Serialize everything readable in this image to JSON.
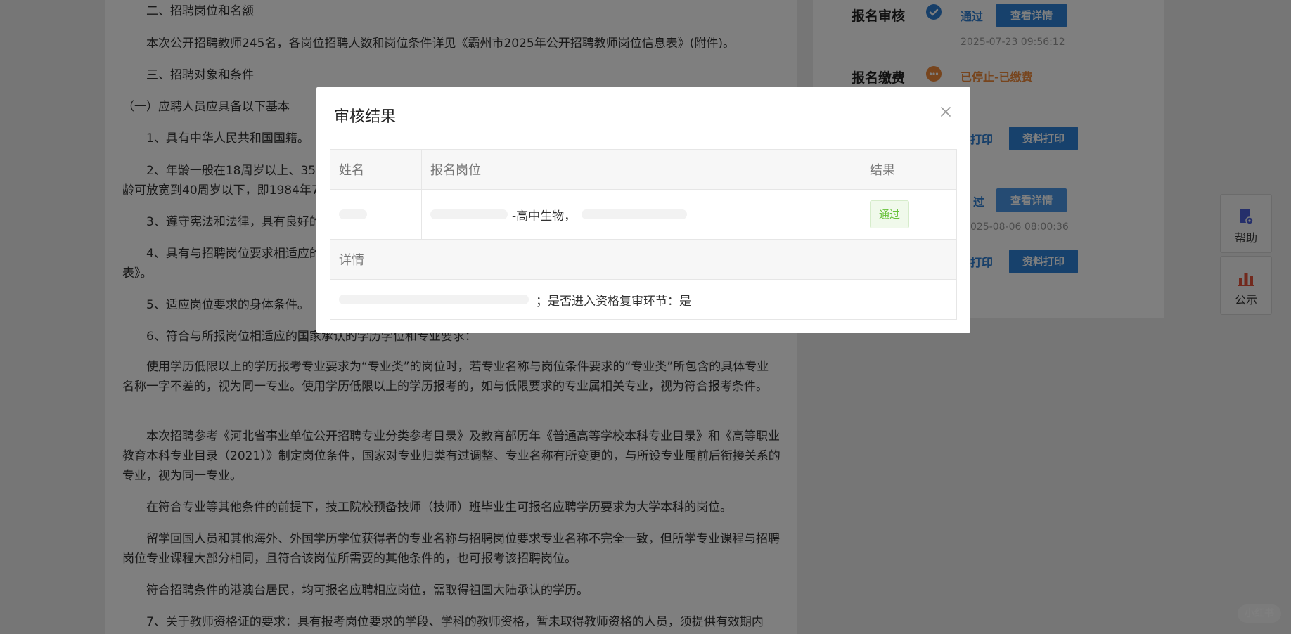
{
  "article": {
    "paragraphs": [
      "二、招聘岗位和名额",
      "本次公开招聘教师245名，各岗位招聘人数和岗位条件详见《霸州市2025年公开招聘教师岗位信息表》(附件)。",
      "三、招聘对象和条件",
      "（一）应聘人员应具备以下基本",
      "1、具有中华人民共和国国籍。",
      "2、年龄一般在18周岁以上、35",
      "龄可放宽到40周岁以下，即1984年7",
      "3、遵守宪法和法律，具有良好的",
      "4、具有与招聘岗位要求相适应的",
      "表》。",
      "5、适应岗位要求的身体条件。",
      "6、符合与所报岗位相适应的国家承认的学历学位和专业要求：",
      "使用学历低限以上的学历报考专业要求为“专业类”的岗位时，若专业名称与岗位条件要求的“专业类”所包含的具体专业名称一字不差的，视为同一专业。使用学历低限以上的学历报考的，如与低限要求的专业属相关专业，视为符合报考条件。",
      "本次招聘参考《河北省事业单位公开招聘专业分类参考目录》及教育部历年《普通高等学校本科专业目录》和《高等职业教育本科专业目录（2021）》制定岗位条件，国家对专业归类有过调整、专业名称有所变更的，与所设专业属前后衔接关系的专业，视为同一专业。",
      "在符合专业等其他条件的前提下，技工院校预备技师（技师）班毕业生可报名应聘学历要求为大学本科的岗位。",
      "留学回国人员和其他海外、外国学历学位获得者的专业名称与招聘岗位要求专业名称不完全一致，但所学专业课程与招聘岗位专业课程大部分相同，且符合该岗位所需要的其他条件的，也可报考该招聘岗位。",
      "符合招聘条件的港澳台居民，均可报名应聘相应岗位，需取得祖国大陆承认的学历。",
      "7、关于教师资格证的要求：具有报考岗位要求的学段、学科的教师资格，暂未取得教师资格的人员，须提供有效期内"
    ]
  },
  "status": {
    "review_title": "报名审核",
    "review_result": "通过",
    "review_button": "查看详情",
    "review_time": "2025-07-23 09:56:12",
    "payment_title": "报名缴费",
    "payment_result": "已停止-已缴费",
    "print_text_1": "打印",
    "print_button_1": "资料打印",
    "pass_text_2": "过",
    "detail_button_2": "查看详情",
    "time_2": "025-08-06 08:00:36",
    "print_text_2": "打印",
    "print_button_2": "资料打印",
    "colors": {
      "pass": "#2f7fd3",
      "stop": "#ee8a3c",
      "button": "#2e82d8"
    }
  },
  "side": {
    "help_label": "帮助",
    "help_icon": "help-doc-icon",
    "notice_label": "公示",
    "notice_icon": "bar-chart-icon"
  },
  "watermark": "小红书",
  "modal": {
    "title": "审核结果",
    "columns": {
      "name": "姓名",
      "position": "报名岗位",
      "result": "结果"
    },
    "row": {
      "position_visible": "-高中生物，",
      "result": "通过"
    },
    "details_label": "详情",
    "details_visible": "；是否进入资格复审环节：是",
    "result_colors": {
      "text": "#67c23a",
      "bg": "#f0f9eb"
    }
  }
}
